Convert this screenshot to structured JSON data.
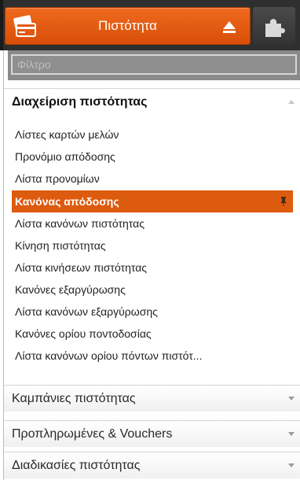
{
  "header": {
    "module_title": "Πιστότητα",
    "module_icon": "credit-card-icon",
    "plugin_icon": "puzzle-icon",
    "accent_color": "#dd5b0e"
  },
  "filter": {
    "placeholder": "Φίλτρο",
    "value": ""
  },
  "sections": {
    "loyalty_management": {
      "label": "Διαχείριση πιστότητας",
      "expanded": true,
      "items": [
        "Λίστες καρτών μελών",
        "Προνόμιο απόδοσης",
        "Λίστα προνομίων",
        "Κανόνας απόδοσης",
        "Λίστα κανόνων πιστότητας",
        "Κίνηση πιστότητας",
        "Λίστα κινήσεων πιστότητας",
        "Κανόνες εξαργύρωσης",
        "Λίστα κανόνων εξαργύρωσης",
        "Κανόνες ορίου ποντοδοσίας",
        "Λίστα κανόνων ορίου πόντων πιστότ..."
      ],
      "active_item": "Κανόνας απόδοσης"
    },
    "campaigns": {
      "label": "Καμπάνιες πιστότητας",
      "expanded": false
    },
    "prepaid": {
      "label": "Προπληρωμένες & Vouchers",
      "expanded": false
    },
    "processes": {
      "label": "Διαδικασίες πιστότητας",
      "expanded": false
    }
  }
}
